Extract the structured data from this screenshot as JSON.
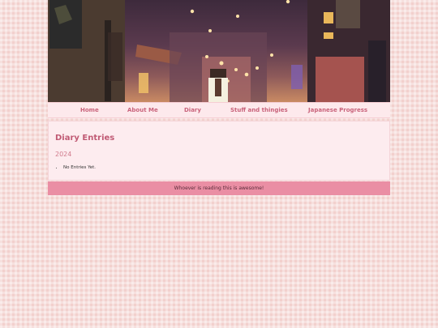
{
  "nav": {
    "items": [
      {
        "label": "Home"
      },
      {
        "label": "About Me"
      },
      {
        "label": "Diary"
      },
      {
        "label": "Stuff and thingies"
      },
      {
        "label": "Japanese Progress"
      }
    ]
  },
  "main": {
    "title": "Diary Entries",
    "year": "2024",
    "entries": [
      "No Entries Yet."
    ]
  },
  "footer": {
    "text": "Whoever is reading this is awesome!"
  },
  "colors": {
    "accent": "#c9637b",
    "footer_bg": "#ea8ea4",
    "page_bg": "#f2d0cd"
  }
}
